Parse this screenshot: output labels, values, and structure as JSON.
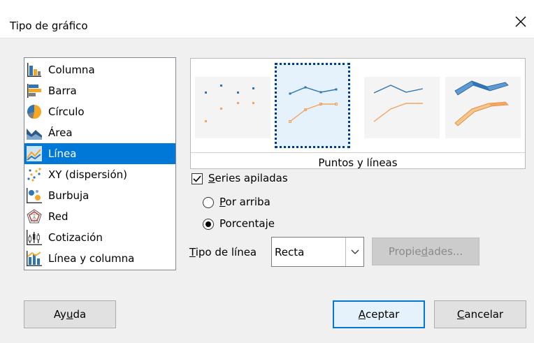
{
  "dialog": {
    "title": "Tipo de gráfico",
    "close_label": "×"
  },
  "chart_types": [
    {
      "label": "Columna",
      "icon": "column-chart-icon",
      "selected": false
    },
    {
      "label": "Barra",
      "icon": "bar-chart-icon",
      "selected": false
    },
    {
      "label": "Círculo",
      "icon": "pie-chart-icon",
      "selected": false
    },
    {
      "label": "Área",
      "icon": "area-chart-icon",
      "selected": false
    },
    {
      "label": "Línea",
      "icon": "line-chart-icon",
      "selected": true
    },
    {
      "label": "XY (dispersión)",
      "icon": "scatter-chart-icon",
      "selected": false
    },
    {
      "label": "Burbuja",
      "icon": "bubble-chart-icon",
      "selected": false
    },
    {
      "label": "Red",
      "icon": "net-chart-icon",
      "selected": false
    },
    {
      "label": "Cotización",
      "icon": "stock-chart-icon",
      "selected": false
    },
    {
      "label": "Línea y columna",
      "icon": "column-line-chart-icon",
      "selected": false
    }
  ],
  "variants": {
    "selected_caption": "Puntos y líneas",
    "items": [
      "points-only",
      "points-and-lines",
      "lines-only",
      "3d-lines"
    ]
  },
  "options": {
    "stacked_label_prefix": "S",
    "stacked_label_rest": "eries apiladas",
    "stacked_checked": true,
    "on_top_prefix": "P",
    "on_top_rest": "or arriba",
    "percent_label": "Porcentaje",
    "percent_selected": true
  },
  "line_type": {
    "label_prefix": "T",
    "label_rest": "ipo de línea",
    "value": "Recta",
    "properties_pre": "Propie",
    "properties_u": "d",
    "properties_post": "ades..."
  },
  "buttons": {
    "help_pre": "Ay",
    "help_u": "u",
    "help_post": "da",
    "ok_u": "A",
    "ok_rest": "ceptar",
    "cancel_u": "C",
    "cancel_rest": "ancelar"
  },
  "colors": {
    "selection": "#0078d7",
    "series_blue": "#2e75b6",
    "series_orange": "#f4a460"
  }
}
